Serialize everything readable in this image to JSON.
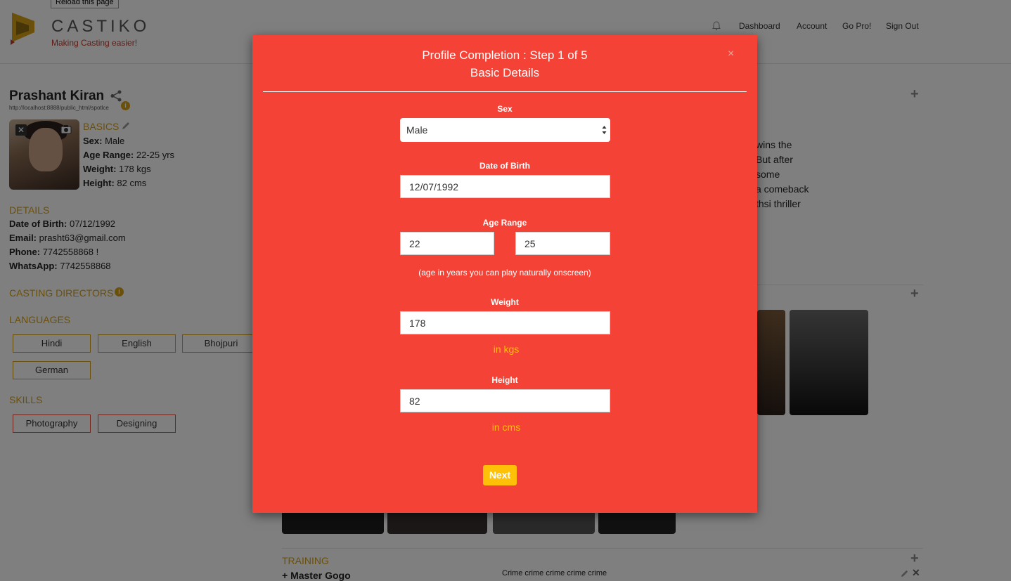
{
  "tooltip": "Reload this page",
  "brand": {
    "name": "CASTIKO",
    "tagline": "Making Casting easier!"
  },
  "nav": {
    "dashboard": "Dashboard",
    "account": "Account",
    "go_pro": "Go Pro!",
    "sign_out": "Sign Out"
  },
  "profile": {
    "name": "Prashant Kiran",
    "url": "http://localhost:8888/public_html/spotlce",
    "basics": {
      "heading": "BASICS",
      "sex_label": "Sex:",
      "sex": "Male",
      "age_label": "Age Range:",
      "age": "22-25 yrs",
      "weight_label": "Weight:",
      "weight": "178 kgs",
      "height_label": "Height:",
      "height": "82 cms"
    },
    "details": {
      "heading": "DETAILS",
      "dob_label": "Date of Birth:",
      "dob": "07/12/1992",
      "email_label": "Email:",
      "email": "prasht63@gmail.com",
      "phone_label": "Phone:",
      "phone": "7742558868 !",
      "whatsapp_label": "WhatsApp:",
      "whatsapp": "7742558868"
    },
    "casting_directors_heading": "CASTING DIRECTORS",
    "languages_heading": "LANGUAGES",
    "languages": [
      "Hindi",
      "English",
      "Bhojpuri",
      "German"
    ],
    "skills_heading": "SKILLS",
    "skills": [
      "Photography",
      "Designing"
    ]
  },
  "bio_fragments": [
    "wins the",
    "But after",
    "some",
    "a comeback",
    "thsi thriller"
  ],
  "training": {
    "heading": "TRAINING",
    "item": "+ Master Gogo",
    "desc": "Crime crime crime crime crime"
  },
  "modal": {
    "title_line1": "Profile Completion : Step 1 of 5",
    "title_line2": "Basic Details",
    "close": "×",
    "sex_label": "Sex",
    "sex_value": "Male",
    "dob_label": "Date of Birth",
    "dob_value": "12/07/1992",
    "age_label": "Age Range",
    "age_min": "22",
    "age_max": "25",
    "age_hint": "(age in years you can play naturally onscreen)",
    "weight_label": "Weight",
    "weight_value": "178",
    "weight_unit": "in kgs",
    "height_label": "Height",
    "height_value": "82",
    "height_unit": "in cms",
    "next": "Next"
  },
  "colors": {
    "modal_bg": "#f44336",
    "accent_gold": "#d4a017",
    "button_yellow": "#ffc107"
  }
}
